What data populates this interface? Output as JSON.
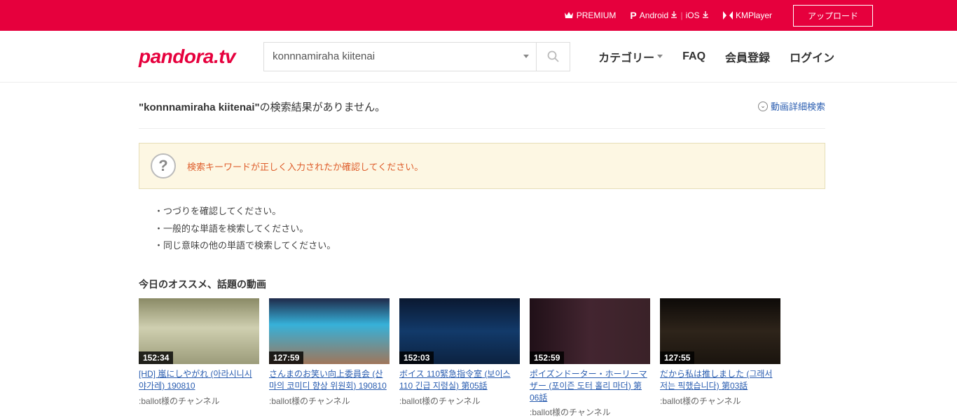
{
  "topbar": {
    "premium": "PREMIUM",
    "android": "Android",
    "ios": "iOS",
    "kmplayer": "KMPlayer",
    "upload": "アップロード"
  },
  "header": {
    "logo": "pandora.tv",
    "search_value": "konnnamiraha kiitenai",
    "category": "カテゴリー",
    "faq": "FAQ",
    "register": "会員登録",
    "login": "ログイン"
  },
  "result": {
    "quoted": "\"konnnamiraha kiitenai\"",
    "suffix": "の検索結果がありません。",
    "adv_label": "動画詳細検索"
  },
  "warn": {
    "text": "検索キーワードが正しく入力されたか確認してください。"
  },
  "tips": {
    "l1": "・つづりを確認してください。",
    "l2": "・一般的な単語を検索してください。",
    "l3": "・同じ意味の他の単語で検索してください。"
  },
  "section": {
    "title": "今日のオススメ、話題の動画"
  },
  "videos": [
    {
      "duration": "152:34",
      "title": "[HD] 嵐にしやがれ (아라시니시야가레) 190810",
      "channel": ":ballot様のチャンネル"
    },
    {
      "duration": "127:59",
      "title": "さんまのお笑い向上委員会 (산마의 코미디 향상 위원회) 190810",
      "channel": ":ballot様のチャンネル"
    },
    {
      "duration": "152:03",
      "title": "ボイス 110緊急指令室 (보이스 110 긴급 지령실) 第05話",
      "channel": ":ballot様のチャンネル"
    },
    {
      "duration": "152:59",
      "title": "ポイズンドーター・ホーリーマザー (포이즌 도터 홀리 마더) 第06話",
      "channel": ":ballot様のチャンネル"
    },
    {
      "duration": "127:55",
      "title": "だから私は推しました (그래서 저는 픽했습니다) 第03話",
      "channel": ":ballot様のチャンネル"
    }
  ]
}
